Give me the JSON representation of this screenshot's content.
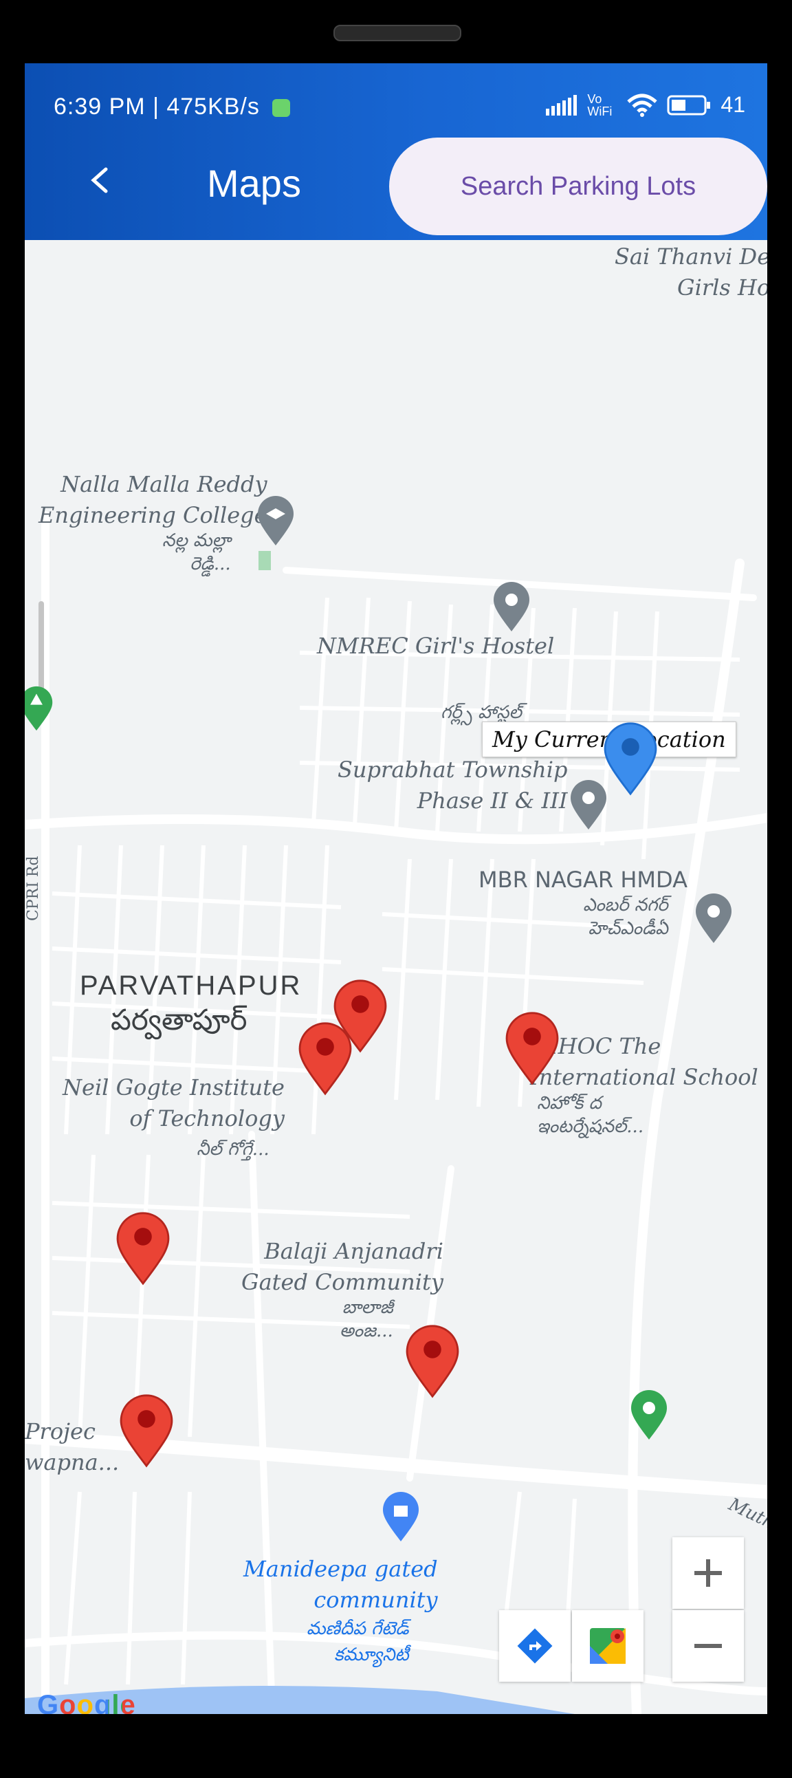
{
  "status": {
    "time_speed": "6:39 PM | 475KB/s",
    "network": "Vo WiFi",
    "battery": "41"
  },
  "appbar": {
    "title": "Maps",
    "search_button": "Search Parking Lots"
  },
  "map": {
    "places": {
      "sai_thanvi": "Sai Thanvi De\nGirls Ho",
      "nalla_malla": "Nalla Malla Reddy\nEngineering College",
      "nalla_malla_te": "నల్ల మల్లా\nరెడ్డి...",
      "nmrec": "NMREC Girl's Hostel",
      "nmrec_te": "గర్ల్స్ హాస్టల్",
      "suprabhat": "Suprabhat Township\nPhase II & III",
      "mbr": "MBR NAGAR HMDA",
      "mbr_te": "ఎంబర్ నగర్\nహెచ్ఎండీఏ",
      "parvathapur": "PARVATHAPUR",
      "parvathapur_te": "పర్వతాపూర్",
      "neil_gogte": "Neil Gogte Institute\nof Technology",
      "neil_gogte_te": "నీల్ గోగ్తే...",
      "nihoc": "NIHOC The\nInternational School",
      "nihoc_te": "నిహోక్ ద\nఇంటర్నేషనల్...",
      "balaji": "Balaji Anjanadri\nGated Community",
      "balaji_te": "బాలాజీ\nఅంజ...",
      "project": "Projec\nwapna...",
      "manideepa": "Manideepa gated\ncommunity",
      "manideepa_te": "మణిదీప గేటెడ్\nకమ్యూనిటీ",
      "cpri_rd": "CPRI Rd",
      "muth": "Muth"
    },
    "current_location_label": "My Current Location",
    "attribution": "Google"
  }
}
